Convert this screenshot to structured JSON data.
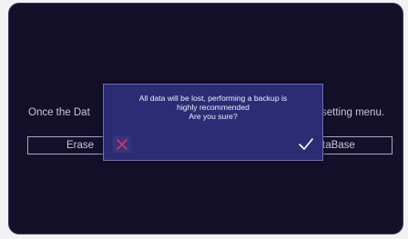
{
  "background": {
    "left_text": "Once the Dat",
    "right_text": "setting menu.",
    "erase_button_label": "Erase",
    "database_button_label": "taBase"
  },
  "dialog": {
    "message_lines": [
      "All data will be lost, performing a backup is",
      "highly recommended",
      "Are you sure?"
    ],
    "cancel_icon": "x-icon",
    "confirm_icon": "check-icon"
  },
  "colors": {
    "screen_bg": "#14102a",
    "dialog_bg": "#2b2c74",
    "cancel_red": "#e0306a",
    "confirm_white": "#ffffff"
  }
}
